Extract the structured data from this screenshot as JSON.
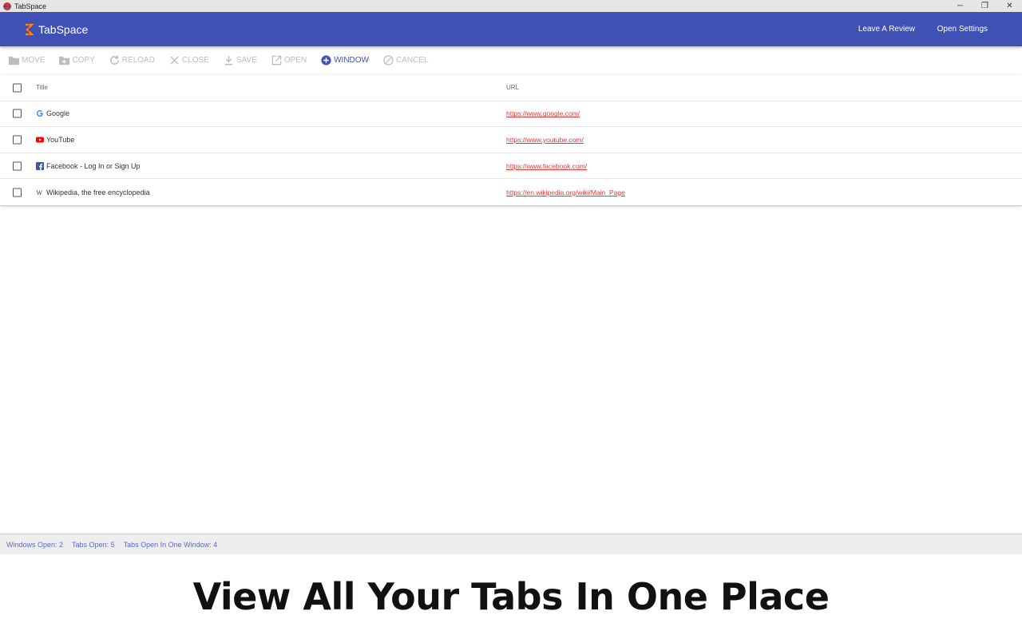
{
  "window": {
    "title": "TabSpace",
    "controls": [
      "─",
      "❐",
      "✕"
    ]
  },
  "app": {
    "name": "TabSpace",
    "accent": "#3f51b5",
    "actions": {
      "review": "Leave A Review",
      "settings": "Open Settings"
    }
  },
  "toolbar": {
    "move": "MOVE",
    "copy": "COPY",
    "reload": "RELOAD",
    "close": "CLOSE",
    "save": "SAVE",
    "open": "OPEN",
    "window": "WINDOW",
    "cancel": "CANCEL"
  },
  "table": {
    "headers": {
      "title": "Title",
      "url": "URL"
    },
    "rows": [
      {
        "title": "Google",
        "url": "https://www.google.com/",
        "icon": "google-icon"
      },
      {
        "title": "YouTube",
        "url": "https://www.youtube.com/",
        "icon": "youtube-icon"
      },
      {
        "title": "Facebook - Log In or Sign Up",
        "url": "https://www.facebook.com/",
        "icon": "facebook-icon"
      },
      {
        "title": "Wikipedia, the free encyclopedia",
        "url": "https://en.wikipedia.org/wiki/Main_Page",
        "icon": "wikipedia-icon"
      }
    ]
  },
  "status": {
    "windows": "Windows Open: 2",
    "tabs": "Tabs Open: 5",
    "one_window": "Tabs Open In One Window: 4"
  },
  "caption": "View All Your Tabs In One Place"
}
